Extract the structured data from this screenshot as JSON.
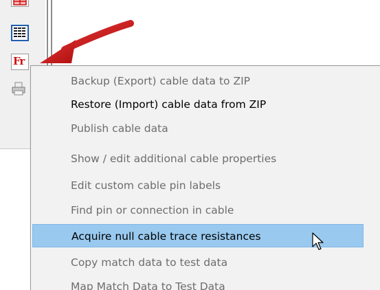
{
  "colors": {
    "menu_background": "#f2f2f2",
    "highlight": "#99c9ef",
    "disabled_text": "#6d6d6d",
    "enabled_text": "#000000",
    "arrow": "#cc1a1a"
  },
  "toolbar": {
    "buttons": [
      {
        "name": "partial-red-icon"
      },
      {
        "name": "grid-icon"
      },
      {
        "name": "fr-icon",
        "text": "Fr"
      },
      {
        "name": "printer-icon"
      }
    ]
  },
  "menu": {
    "items": [
      {
        "label": "Backup (Export) cable data to ZIP",
        "enabled": false
      },
      {
        "label": "Restore (Import) cable data from ZIP",
        "enabled": true
      },
      {
        "label": "Publish cable data",
        "enabled": false
      },
      {
        "label": "Show / edit additional cable properties",
        "enabled": false
      },
      {
        "label": "Edit custom cable pin labels",
        "enabled": false
      },
      {
        "label": "Find pin or connection in cable",
        "enabled": false
      },
      {
        "label": "Acquire null cable trace resistances",
        "enabled": true,
        "highlighted": true
      },
      {
        "label": "Copy match data to test data",
        "enabled": false
      },
      {
        "label": "Map Match Data to Test Data",
        "enabled": false
      }
    ]
  }
}
